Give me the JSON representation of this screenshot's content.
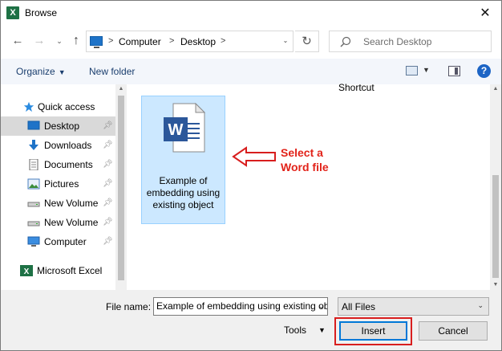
{
  "window": {
    "title": "Browse",
    "app_icon": "excel-icon",
    "close_glyph": "✕"
  },
  "address": {
    "crumbs": [
      "Computer",
      "Desktop"
    ],
    "search_placeholder": "Search Desktop"
  },
  "toolbar": {
    "organize_label": "Organize",
    "new_folder_label": "New folder",
    "help_glyph": "?"
  },
  "navigation": {
    "items": [
      {
        "label": "Quick access",
        "icon": "star-icon"
      },
      {
        "label": "Desktop",
        "icon": "desktop-icon",
        "selected": true
      },
      {
        "label": "Downloads",
        "icon": "download-icon"
      },
      {
        "label": "Documents",
        "icon": "documents-icon"
      },
      {
        "label": "Pictures",
        "icon": "pictures-icon"
      },
      {
        "label": "New Volume",
        "icon": "drive-icon"
      },
      {
        "label": "New Volume",
        "icon": "drive-icon"
      },
      {
        "label": "Computer",
        "icon": "computer-icon"
      },
      {
        "label": "Microsoft Excel",
        "icon": "excel-icon"
      }
    ]
  },
  "files": {
    "partial_item_label": "Shortcut",
    "selected_file": {
      "name": "Example of embedding using existing object",
      "icon": "word-document-icon"
    }
  },
  "annotation": {
    "text_line1": "Select a",
    "text_line2": "Word file",
    "color": "#e2231a"
  },
  "bottom": {
    "file_name_label": "File name:",
    "file_name_value": "Example of embedding using existing object",
    "filter_value": "All Files",
    "tools_label": "Tools",
    "insert_label": "Insert",
    "cancel_label": "Cancel"
  },
  "colors": {
    "selection_bg": "#cce8ff",
    "accent": "#0078d7",
    "highlight_border": "#d81e1e",
    "word_blue": "#2b579a",
    "excel_green": "#1e7145"
  }
}
